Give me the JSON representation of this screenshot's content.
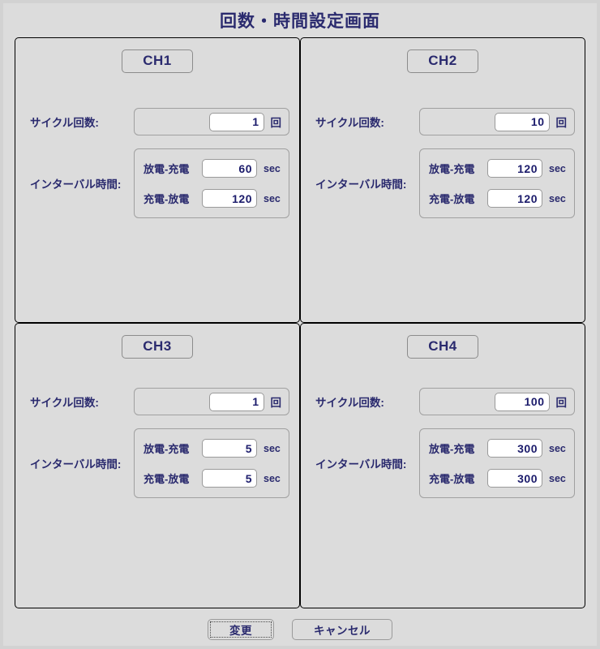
{
  "window": {
    "title": "回数・時間設定画面"
  },
  "labels": {
    "cycle_count": "サイクル回数:",
    "interval_time": "インターバル時間:",
    "discharge_charge": "放電-充電",
    "charge_discharge": "充電-放電",
    "unit_times": "回",
    "unit_sec": "sec"
  },
  "channels": [
    {
      "name": "CH1",
      "cycle_count": "1",
      "discharge_charge": "60",
      "charge_discharge": "120"
    },
    {
      "name": "CH2",
      "cycle_count": "10",
      "discharge_charge": "120",
      "charge_discharge": "120"
    },
    {
      "name": "CH3",
      "cycle_count": "1",
      "discharge_charge": "5",
      "charge_discharge": "5"
    },
    {
      "name": "CH4",
      "cycle_count": "100",
      "discharge_charge": "300",
      "charge_discharge": "300"
    }
  ],
  "footer": {
    "apply_label": "変更",
    "cancel_label": "キャンセル"
  },
  "colors": {
    "text_navy": "#2a2a6e",
    "value_navy": "#1b1b6b",
    "panel_bg": "#dcdcdc",
    "window_bg": "#d2d2d2",
    "field_bg": "#ffffff"
  }
}
